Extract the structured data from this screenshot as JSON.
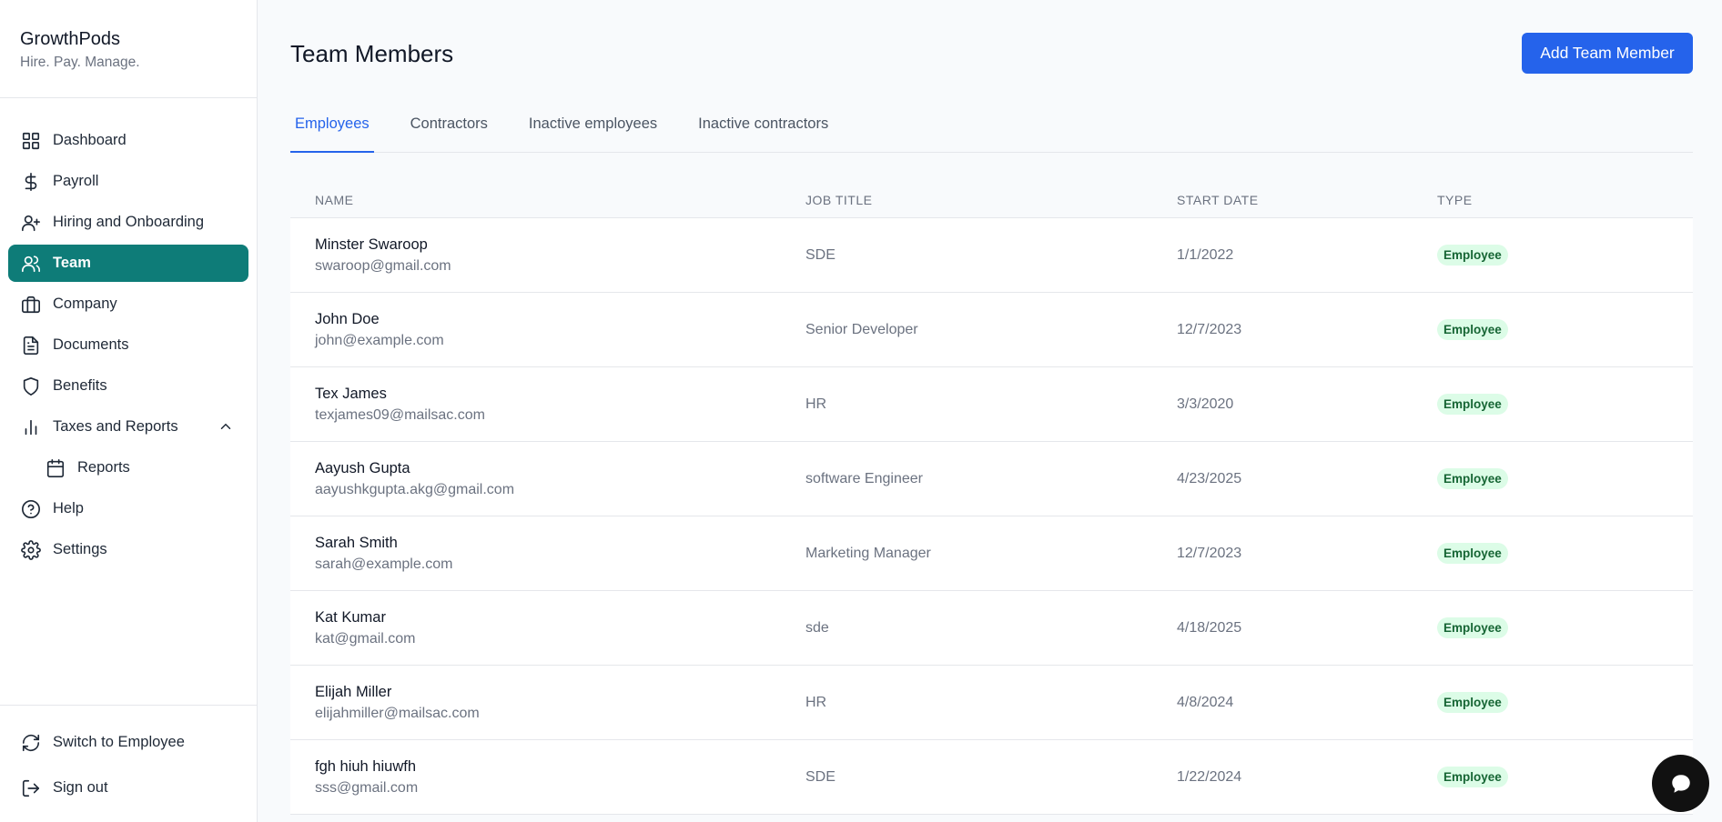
{
  "brand": {
    "name": "GrowthPods",
    "tagline": "Hire. Pay. Manage."
  },
  "sidebar": {
    "items": [
      {
        "label": "Dashboard",
        "icon": "grid-icon"
      },
      {
        "label": "Payroll",
        "icon": "dollar-icon"
      },
      {
        "label": "Hiring and Onboarding",
        "icon": "user-plus-icon"
      },
      {
        "label": "Team",
        "icon": "users-icon",
        "active": true
      },
      {
        "label": "Company",
        "icon": "briefcase-icon"
      },
      {
        "label": "Documents",
        "icon": "document-icon"
      },
      {
        "label": "Benefits",
        "icon": "shield-icon"
      },
      {
        "label": "Taxes and Reports",
        "icon": "bar-chart-icon",
        "expanded": true
      },
      {
        "label": "Reports",
        "icon": "calendar-icon",
        "sub": true
      },
      {
        "label": "Help",
        "icon": "help-circle-icon"
      },
      {
        "label": "Settings",
        "icon": "gear-icon"
      }
    ],
    "footer": [
      {
        "label": "Switch to Employee",
        "icon": "refresh-icon"
      },
      {
        "label": "Sign out",
        "icon": "logout-icon"
      }
    ]
  },
  "header": {
    "title": "Team Members",
    "add_button": "Add Team Member"
  },
  "tabs": [
    {
      "label": "Employees",
      "active": true
    },
    {
      "label": "Contractors"
    },
    {
      "label": "Inactive employees"
    },
    {
      "label": "Inactive contractors"
    }
  ],
  "table": {
    "headers": [
      "NAME",
      "JOB TITLE",
      "START DATE",
      "TYPE"
    ],
    "rows": [
      {
        "name": "Minster Swaroop",
        "email": "swaroop@gmail.com",
        "job_title": "SDE",
        "start_date": "1/1/2022",
        "type": "Employee"
      },
      {
        "name": "John Doe",
        "email": "john@example.com",
        "job_title": "Senior Developer",
        "start_date": "12/7/2023",
        "type": "Employee"
      },
      {
        "name": "Tex James",
        "email": "texjames09@mailsac.com",
        "job_title": "HR",
        "start_date": "3/3/2020",
        "type": "Employee"
      },
      {
        "name": "Aayush Gupta",
        "email": "aayushkgupta.akg@gmail.com",
        "job_title": "software Engineer",
        "start_date": "4/23/2025",
        "type": "Employee"
      },
      {
        "name": "Sarah Smith",
        "email": "sarah@example.com",
        "job_title": "Marketing Manager",
        "start_date": "12/7/2023",
        "type": "Employee"
      },
      {
        "name": "Kat Kumar",
        "email": "kat@gmail.com",
        "job_title": "sde",
        "start_date": "4/18/2025",
        "type": "Employee"
      },
      {
        "name": "Elijah Miller",
        "email": "elijahmiller@mailsac.com",
        "job_title": "HR",
        "start_date": "4/8/2024",
        "type": "Employee"
      },
      {
        "name": "fgh hiuh hiuwfh",
        "email": "sss@gmail.com",
        "job_title": "SDE",
        "start_date": "1/22/2024",
        "type": "Employee"
      }
    ]
  },
  "colors": {
    "accent": "#2563eb",
    "active_nav": "#0e7c78",
    "badge_bg": "#dcfce7",
    "badge_text": "#166534"
  },
  "chat": {
    "icon": "chat-bubble-icon"
  }
}
